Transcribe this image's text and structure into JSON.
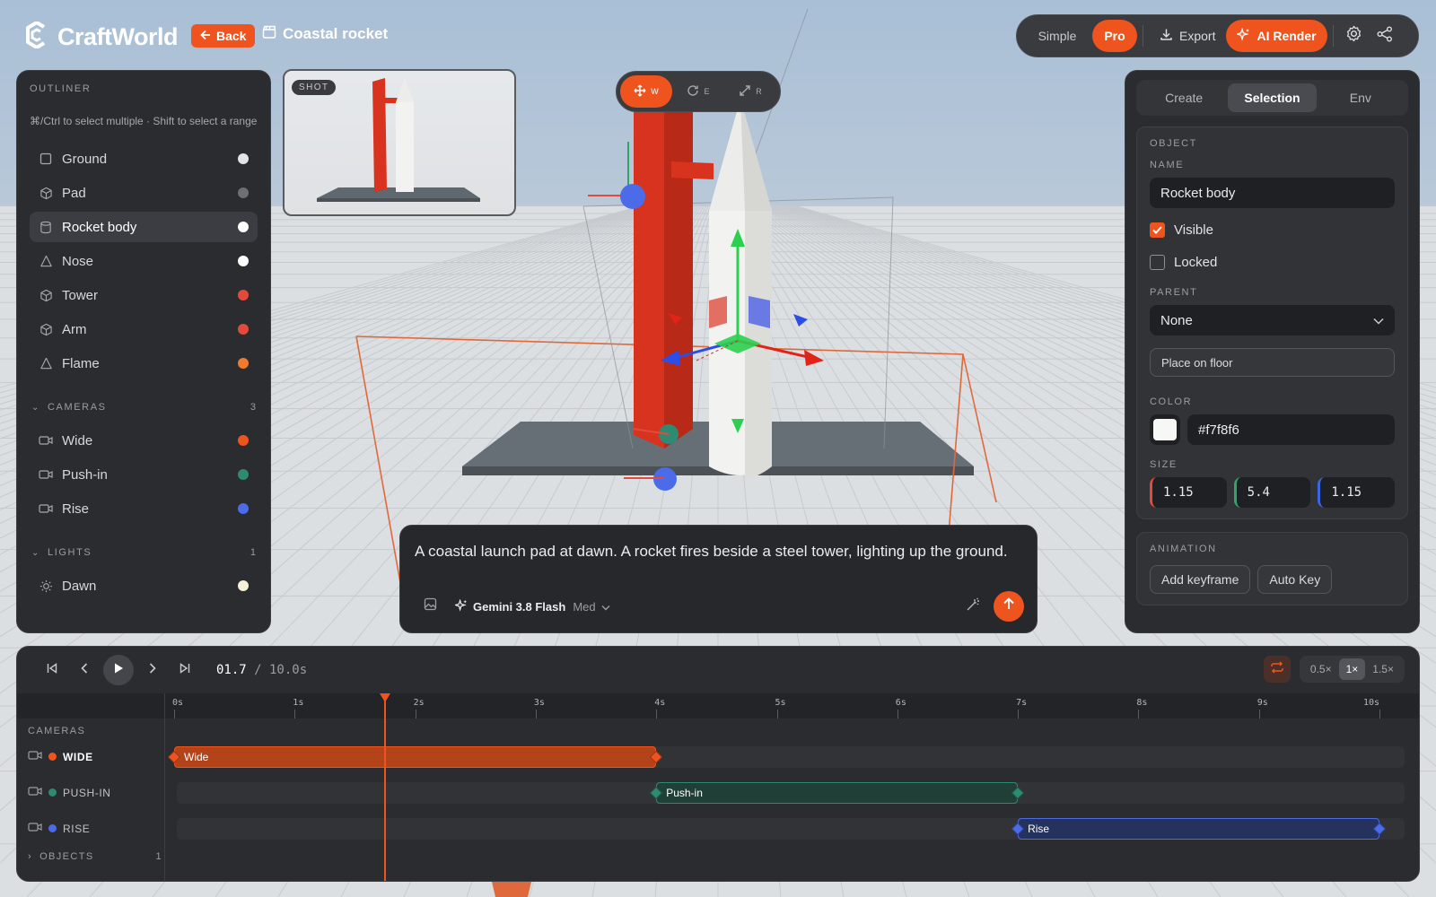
{
  "app": {
    "logo_text": "CraftWorld",
    "back_label": "Back",
    "project_name": "Coastal rocket",
    "accent": "#f0541e"
  },
  "topbar": {
    "mode_simple": "Simple",
    "mode_pro": "Pro",
    "export_label": "Export",
    "ai_render_label": "AI Render",
    "icons": [
      "download-icon",
      "sparkle-icon",
      "gear-icon",
      "share-icon"
    ]
  },
  "outliner": {
    "title": "OUTLINER",
    "hint": "⌘/Ctrl to select multiple · Shift to select a range",
    "objects": [
      {
        "name": "Ground",
        "icon": "square-icon",
        "color": "#e4e4e6"
      },
      {
        "name": "Pad",
        "icon": "cube-icon",
        "color": "#6e6f74"
      },
      {
        "name": "Rocket body",
        "icon": "cylinder-icon",
        "color": "#ffffff",
        "selected": true
      },
      {
        "name": "Nose",
        "icon": "cone-icon",
        "color": "#ffffff"
      },
      {
        "name": "Tower",
        "icon": "cube-icon",
        "color": "#e24a3c"
      },
      {
        "name": "Arm",
        "icon": "cube-icon",
        "color": "#e24a3c"
      },
      {
        "name": "Flame",
        "icon": "cone-icon",
        "color": "#f07a2e"
      }
    ],
    "cameras": {
      "label": "CAMERAS",
      "count": "3",
      "items": [
        {
          "name": "Wide",
          "color": "#f0541e"
        },
        {
          "name": "Push-in",
          "color": "#2f8a73"
        },
        {
          "name": "Rise",
          "color": "#4b6be8"
        }
      ]
    },
    "lights": {
      "label": "LIGHTS",
      "count": "1",
      "items": [
        {
          "name": "Dawn",
          "color": "#f8f1da"
        }
      ]
    }
  },
  "shot": {
    "badge": "SHOT"
  },
  "gizmo_modes": [
    {
      "key": "W",
      "icon": "move-icon",
      "active": true
    },
    {
      "key": "E",
      "icon": "rotate-icon",
      "active": false
    },
    {
      "key": "R",
      "icon": "scale-icon",
      "active": false
    }
  ],
  "props": {
    "tabs": [
      "Create",
      "Selection",
      "Env"
    ],
    "active_tab": "Selection",
    "object_section": "OBJECT",
    "name_label": "NAME",
    "name_value": "Rocket body",
    "visible_label": "Visible",
    "visible": true,
    "locked_label": "Locked",
    "locked": false,
    "parent_label": "PARENT",
    "parent_value": "None",
    "place_floor_label": "Place on floor",
    "color_label": "COLOR",
    "color_value": "#f7f8f6",
    "size_label": "SIZE",
    "size": {
      "x": "1.15",
      "y": "5.4",
      "z": "1.15"
    },
    "animation_section": "ANIMATION",
    "add_keyframe_label": "Add keyframe",
    "auto_key_label": "Auto Key"
  },
  "prompt": {
    "text": "A coastal launch pad at dawn. A rocket fires beside a steel tower, lighting up the ground.",
    "model_name": "Gemini 3.8 Flash",
    "model_tier": "Med"
  },
  "timeline": {
    "current_time": "01.7",
    "total_time": " / 10.0s",
    "duration_s": 10,
    "playhead_s": 1.75,
    "speeds": [
      "0.5×",
      "1×",
      "1.5×"
    ],
    "active_speed": "1×",
    "ticks": [
      "0s",
      "1s",
      "2s",
      "3s",
      "4s",
      "5s",
      "6s",
      "7s",
      "8s",
      "9s",
      "10s"
    ],
    "cameras_label": "CAMERAS",
    "objects_label": "OBJECTS",
    "objects_count": "1",
    "tracks": [
      {
        "label": "WIDE",
        "clip": "Wide",
        "start": 0,
        "end": 4,
        "color": "#f0541e",
        "fill": "#b34318",
        "selected": true
      },
      {
        "label": "PUSH-IN",
        "clip": "Push-in",
        "start": 4,
        "end": 7,
        "color": "#2f8a73",
        "fill": "#1f3f37",
        "selected": false
      },
      {
        "label": "RISE",
        "clip": "Rise",
        "start": 7,
        "end": 10,
        "color": "#4b6be8",
        "fill": "#25325e",
        "selected": false
      }
    ]
  }
}
